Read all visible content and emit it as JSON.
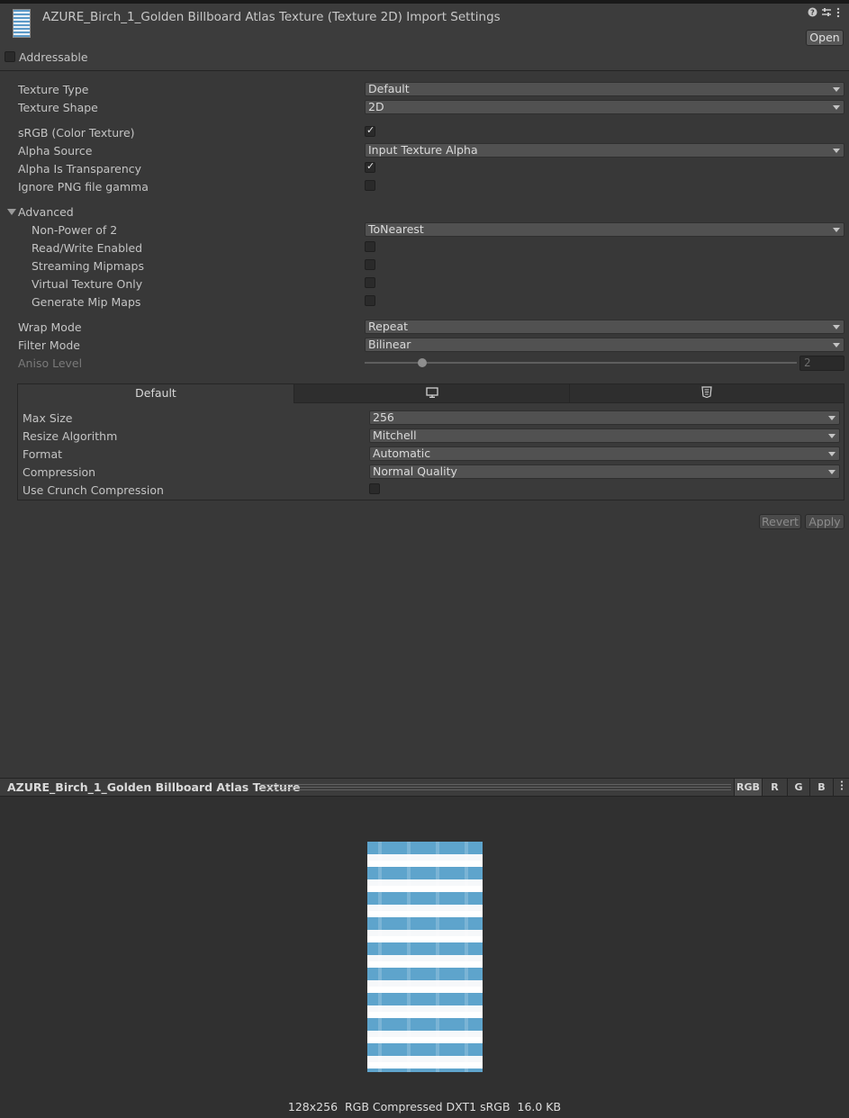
{
  "header": {
    "title": "AZURE_Birch_1_Golden Billboard Atlas Texture (Texture 2D) Import Settings",
    "open_label": "Open",
    "addressable_label": "Addressable",
    "addressable_checked": false
  },
  "fields": {
    "texture_type": {
      "label": "Texture Type",
      "value": "Default"
    },
    "texture_shape": {
      "label": "Texture Shape",
      "value": "2D"
    },
    "srgb": {
      "label": "sRGB (Color Texture)",
      "checked": true
    },
    "alpha_source": {
      "label": "Alpha Source",
      "value": "Input Texture Alpha"
    },
    "alpha_is_transparency": {
      "label": "Alpha Is Transparency",
      "checked": true
    },
    "ignore_png_gamma": {
      "label": "Ignore PNG file gamma",
      "checked": false
    },
    "advanced": {
      "label": "Advanced"
    },
    "non_power_of_2": {
      "label": "Non-Power of 2",
      "value": "ToNearest"
    },
    "read_write": {
      "label": "Read/Write Enabled",
      "checked": false
    },
    "streaming_mipmaps": {
      "label": "Streaming Mipmaps",
      "checked": false
    },
    "virtual_texture_only": {
      "label": "Virtual Texture Only",
      "checked": false
    },
    "generate_mip_maps": {
      "label": "Generate Mip Maps",
      "checked": false
    },
    "wrap_mode": {
      "label": "Wrap Mode",
      "value": "Repeat"
    },
    "filter_mode": {
      "label": "Filter Mode",
      "value": "Bilinear"
    },
    "aniso_level": {
      "label": "Aniso Level",
      "value": "2"
    }
  },
  "platform": {
    "tab_default": "Default",
    "max_size": {
      "label": "Max Size",
      "value": "256"
    },
    "resize_algorithm": {
      "label": "Resize Algorithm",
      "value": "Mitchell"
    },
    "format": {
      "label": "Format",
      "value": "Automatic"
    },
    "compression": {
      "label": "Compression",
      "value": "Normal Quality"
    },
    "crunch": {
      "label": "Use Crunch Compression",
      "checked": false
    }
  },
  "actions": {
    "revert": "Revert",
    "apply": "Apply"
  },
  "preview": {
    "title": "AZURE_Birch_1_Golden Billboard Atlas Texture",
    "channels": [
      "RGB",
      "R",
      "G",
      "B"
    ],
    "info": "128x256  RGB Compressed DXT1 sRGB  16.0 KB"
  }
}
